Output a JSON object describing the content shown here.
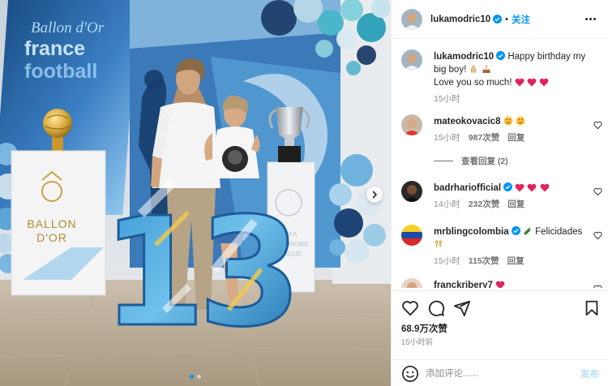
{
  "colors": {
    "accent": "#0095f6",
    "heart": "#ed4956",
    "muted": "#8e8e8e",
    "text": "#262626"
  },
  "header": {
    "username": "lukamodric10",
    "follow_label": "关注",
    "separator": "•"
  },
  "photo": {
    "slide_count": 2,
    "active_slide": 1,
    "board_brand_lines": [
      "Ballon d'Or",
      "france",
      "football"
    ],
    "pedestal_text": [
      "BALLON",
      "D'OR"
    ],
    "number_sign": "13",
    "ucl_text": [
      "UEFA",
      "CHAMPIONS",
      "LEAGUE"
    ]
  },
  "caption": {
    "username": "lukamodric10",
    "text_line1": "Happy birthday my big boy!",
    "text_line2": "Love you so much!",
    "time": "15小时"
  },
  "comments": [
    {
      "username": "mateokovacic8",
      "text": "",
      "time": "15小时",
      "likes": "987次赞",
      "reply": "回复",
      "emoji": "heart-eyes x2"
    },
    {
      "username": "badrhariofficial",
      "verified": true,
      "text": "",
      "time": "14小时",
      "likes": "232次赞",
      "reply": "回复",
      "emoji": "red hearts x3"
    },
    {
      "username": "mrblingcolombia",
      "verified": true,
      "text": "Felicidades",
      "time": "15小时",
      "likes": "115次赞",
      "reply": "回复",
      "emoji": "bottle, cheers"
    },
    {
      "username": "franckribery7",
      "verified": false,
      "text": "",
      "emoji": "red heart"
    }
  ],
  "view_replies": "查看回复 (2)",
  "stats": {
    "likes": "68.9万次赞",
    "ago": "15小时前"
  },
  "composer": {
    "placeholder": "添加评论......",
    "post_label": "发布"
  }
}
